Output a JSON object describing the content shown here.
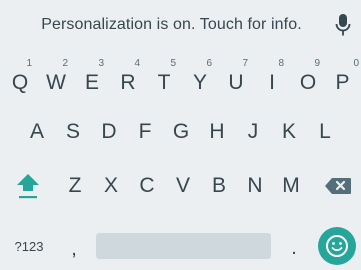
{
  "suggestion_strip": {
    "message": "Personalization is on. Touch for info.",
    "mic_icon": "microphone-icon"
  },
  "rows": {
    "top": [
      {
        "letter": "Q",
        "hint": "1"
      },
      {
        "letter": "W",
        "hint": "2"
      },
      {
        "letter": "E",
        "hint": "3"
      },
      {
        "letter": "R",
        "hint": "4"
      },
      {
        "letter": "T",
        "hint": "5"
      },
      {
        "letter": "Y",
        "hint": "6"
      },
      {
        "letter": "U",
        "hint": "7"
      },
      {
        "letter": "I",
        "hint": "8"
      },
      {
        "letter": "O",
        "hint": "9"
      },
      {
        "letter": "P",
        "hint": "0"
      }
    ],
    "middle": [
      "A",
      "S",
      "D",
      "F",
      "G",
      "H",
      "J",
      "K",
      "L"
    ],
    "bottom": [
      "Z",
      "X",
      "C",
      "V",
      "B",
      "N",
      "M"
    ]
  },
  "function_keys": {
    "shift_icon": "shift-arrow-icon",
    "backspace_icon": "backspace-icon",
    "symbols_label": "?123",
    "comma": ",",
    "period": ".",
    "emoji_icon": "smiley-face-icon"
  },
  "colors": {
    "background": "#eceff1",
    "key_text": "#37474f",
    "accent": "#26a69a",
    "spacebar": "#cfd8dc"
  }
}
